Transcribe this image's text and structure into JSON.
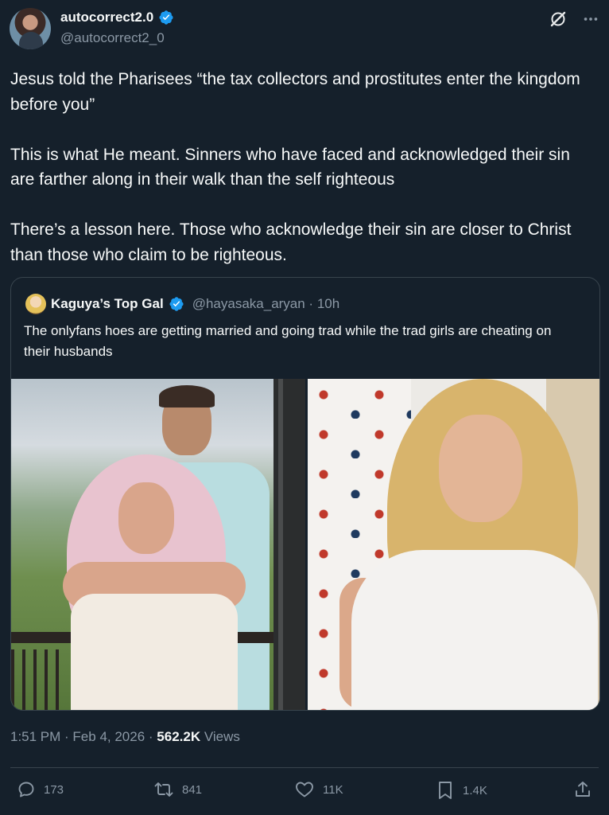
{
  "author": {
    "display_name": "autocorrect2.0",
    "handle": "@autocorrect2_0",
    "verified": true,
    "avatar_icon": "user-avatar"
  },
  "tweet": {
    "paragraphs": [
      "Jesus told the Pharisees “the tax collectors and prostitutes enter the kingdom before you”",
      "This is what He meant. Sinners who have faced and acknowledged their sin are farther along in their walk than the self righteous",
      "There’s a lesson here. Those who acknowledge their sin are closer to Christ than those who claim to be righteous."
    ]
  },
  "quoted_tweet": {
    "display_name": "Kaguya’s Top Gal",
    "handle_time": "@hayasaka_aryan · 10h",
    "verified": true,
    "text": "The onlyfans hoes are getting married and going trad while the trad girls are cheating on their husbands",
    "photos": [
      "couple-photo",
      "woman-photo"
    ]
  },
  "meta": {
    "time": "1:51 PM",
    "separator": " · ",
    "date": "Feb 4, 2026",
    "separator2": " · ",
    "views_count": "562.2K",
    "views_label": " Views"
  },
  "actions": {
    "replies": "173",
    "reposts": "841",
    "likes": "11K",
    "bookmarks": "1.4K"
  },
  "colors": {
    "background": "#15202b",
    "text": "#f7f9f9",
    "secondary": "#8b98a5",
    "border": "#38444d",
    "verified": "#1d9bf0"
  }
}
